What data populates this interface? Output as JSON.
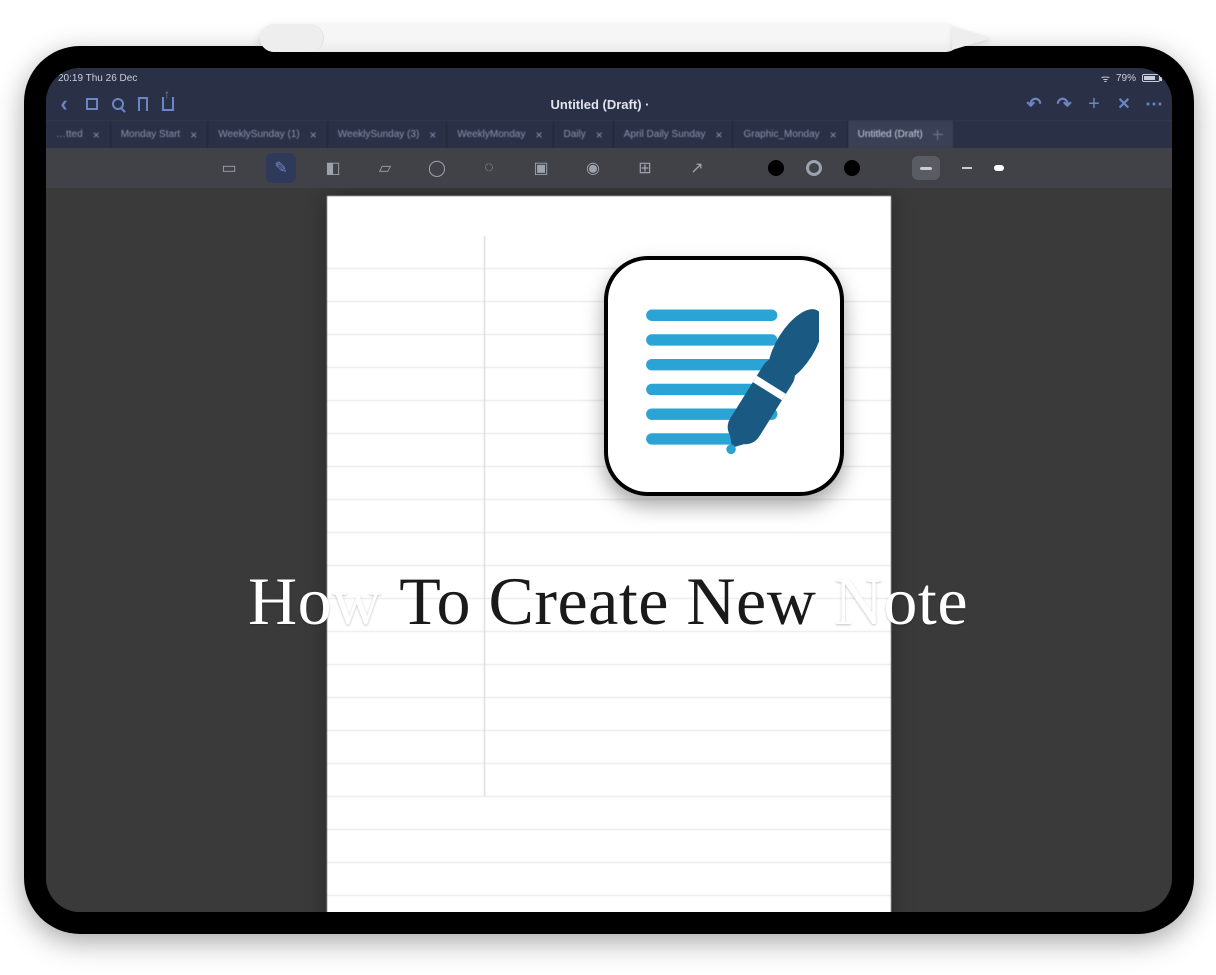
{
  "status_bar": {
    "time_date": "20:19  Thu 26 Dec",
    "battery_pct": "79%",
    "wifi_icon": "wifi"
  },
  "titlebar": {
    "document_title": "Untitled (Draft) ·",
    "left_icons": [
      "back",
      "thumbnails",
      "search",
      "bookmark",
      "share"
    ],
    "right_icons": [
      "undo",
      "redo",
      "add",
      "close",
      "more"
    ]
  },
  "tabs": [
    {
      "label": "…tted",
      "active": false
    },
    {
      "label": "Monday Start",
      "active": false
    },
    {
      "label": "WeeklySunday (1)",
      "active": false
    },
    {
      "label": "WeeklySunday (3)",
      "active": false
    },
    {
      "label": "WeeklyMonday",
      "active": false
    },
    {
      "label": "Daily",
      "active": false
    },
    {
      "label": "April Daily Sunday",
      "active": false
    },
    {
      "label": "Graphic_Monday",
      "active": false
    },
    {
      "label": "Untitled (Draft)",
      "active": true
    }
  ],
  "tools": {
    "items": [
      "view-mode",
      "pen",
      "eraser",
      "highlighter",
      "shapes",
      "lasso",
      "image",
      "camera",
      "text-box",
      "pointer"
    ],
    "selected": "pen",
    "colors": [
      "#000000",
      "ring",
      "#000000"
    ],
    "stroke_styles": [
      "square-medium",
      "dash",
      "pill"
    ]
  },
  "app_icon": {
    "name": "goodnotes-icon",
    "line_color": "#2aa4d4",
    "pen_color": "#1a5a82"
  },
  "caption": {
    "w1": "How",
    "w2": "To Create New",
    "w3": "Note"
  }
}
